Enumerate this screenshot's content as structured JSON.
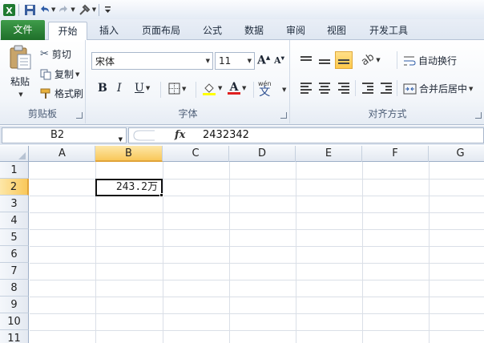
{
  "quick_access": {
    "icons": [
      "excel-logo-icon",
      "save-icon",
      "undo-icon",
      "redo-icon",
      "customize-icon"
    ]
  },
  "tabs": [
    {
      "label": "文件",
      "active": false
    },
    {
      "label": "开始",
      "active": true
    },
    {
      "label": "插入",
      "active": false
    },
    {
      "label": "页面布局",
      "active": false
    },
    {
      "label": "公式",
      "active": false
    },
    {
      "label": "数据",
      "active": false
    },
    {
      "label": "审阅",
      "active": false
    },
    {
      "label": "视图",
      "active": false
    },
    {
      "label": "开发工具",
      "active": false
    }
  ],
  "ribbon": {
    "clipboard": {
      "group_label": "剪贴板",
      "paste_label": "粘贴",
      "cut_label": "剪切",
      "copy_label": "复制",
      "format_painter_label": "格式刷"
    },
    "font": {
      "group_label": "字体",
      "font_name": "宋体",
      "font_size": "11",
      "bold": "B",
      "italic": "I",
      "underline": "U",
      "font_color": "A",
      "phonetic": "wén"
    },
    "alignment": {
      "group_label": "对齐方式",
      "wrap_text_label": "自动换行",
      "merge_center_label": "合并后居中"
    }
  },
  "formula_bar": {
    "name_box": "B2",
    "fx_label": "fx",
    "value": "2432342"
  },
  "grid": {
    "columns": [
      "A",
      "B",
      "C",
      "D",
      "E",
      "F",
      "G"
    ],
    "rows": [
      "1",
      "2",
      "3",
      "4",
      "5",
      "6",
      "7",
      "8",
      "9",
      "10",
      "11"
    ],
    "selected_column": "B",
    "selected_row": "2",
    "cells": {
      "B2": "243.2万"
    }
  },
  "colors": {
    "file_tab": "#2a7d35",
    "selection_header": "#f9c85a",
    "font_color_underline": "#e02020",
    "fill_color_underline": "#ffff00"
  }
}
